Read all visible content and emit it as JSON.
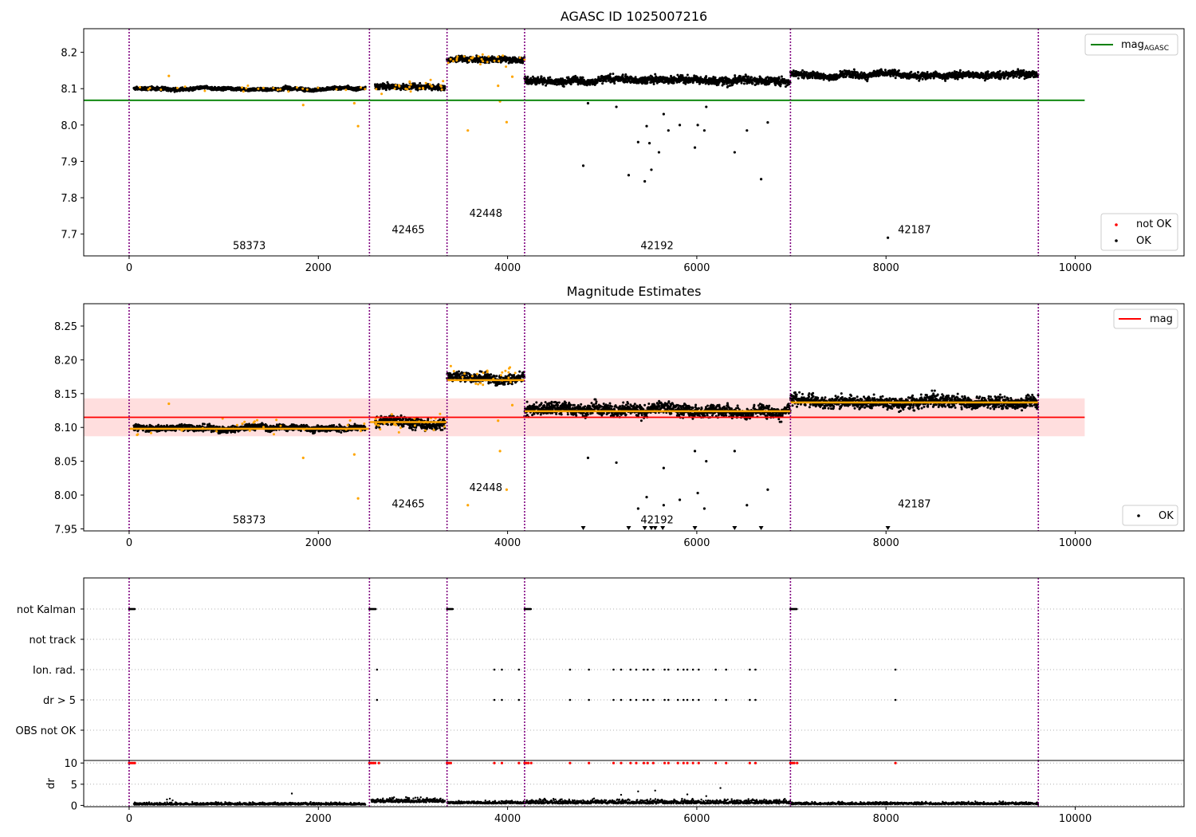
{
  "chart_data": [
    {
      "type": "scatter",
      "title": "AGASC ID 1025007216",
      "xlim": [
        -480,
        11150
      ],
      "ylim": [
        7.64,
        8.265
      ],
      "xticks": [
        "0",
        "2000",
        "4000",
        "6000",
        "8000",
        "10000"
      ],
      "yticks": [
        "7.7",
        "7.8",
        "7.9",
        "8.0",
        "8.1",
        "8.2"
      ],
      "colors": {
        "ok": "#000000",
        "not_ok": "#ff0000",
        "suspect": "#ffa500",
        "agasc_line": "#008000",
        "obsid_line": "#800080"
      },
      "legend_top": [
        {
          "label": "mag",
          "sub": "AGASC",
          "color": "#008000",
          "style": "line"
        }
      ],
      "legend_bottom": [
        {
          "label": "not OK",
          "color": "#ff0000",
          "style": "dot"
        },
        {
          "label": "OK",
          "color": "#000000",
          "style": "dot"
        }
      ],
      "hline": {
        "y": 8.068,
        "x": [
          -480,
          10100
        ]
      },
      "obsid_boundaries": [
        0,
        2540,
        3360,
        4180,
        6990,
        9610
      ],
      "obsid_labels": [
        {
          "text": "58373",
          "x": 1270,
          "y": 7.659
        },
        {
          "text": "42465",
          "x": 2950,
          "y": 7.703
        },
        {
          "text": "42448",
          "x": 3770,
          "y": 7.747
        },
        {
          "text": "42192",
          "x": 5580,
          "y": 7.659
        },
        {
          "text": "42187",
          "x": 8300,
          "y": 7.703
        }
      ],
      "segments": [
        {
          "x": [
            50,
            2500
          ],
          "level": 8.1,
          "noise": 0.004
        },
        {
          "x": [
            2600,
            3340
          ],
          "level": 8.105,
          "noise": 0.007
        },
        {
          "x": [
            3360,
            4180
          ],
          "level": 8.18,
          "noise": 0.007
        },
        {
          "x": [
            4180,
            6990
          ],
          "level": 8.125,
          "noise": 0.009
        },
        {
          "x": [
            6990,
            9610
          ],
          "level": 8.14,
          "noise": 0.008
        }
      ],
      "outliers_ok": [
        [
          4800,
          7.888
        ],
        [
          5280,
          7.862
        ],
        [
          5450,
          7.845
        ],
        [
          5520,
          7.877
        ],
        [
          5380,
          7.953
        ],
        [
          5500,
          7.95
        ],
        [
          5600,
          7.925
        ],
        [
          5980,
          7.938
        ],
        [
          6400,
          7.925
        ],
        [
          6680,
          7.851
        ],
        [
          6750,
          8.007
        ],
        [
          5470,
          7.997
        ],
        [
          5700,
          7.985
        ],
        [
          5820,
          8.0
        ],
        [
          6010,
          8.0
        ],
        [
          6080,
          7.985
        ],
        [
          6530,
          7.985
        ],
        [
          8020,
          7.69
        ],
        [
          4850,
          8.06
        ],
        [
          5150,
          8.05
        ],
        [
          5650,
          8.03
        ],
        [
          6100,
          8.05
        ]
      ],
      "outliers_suspect": [
        [
          1840,
          8.055
        ],
        [
          2420,
          7.997
        ],
        [
          3580,
          7.985
        ],
        [
          3990,
          8.008
        ],
        [
          3920,
          8.065
        ],
        [
          3900,
          8.108
        ],
        [
          4050,
          8.133
        ],
        [
          2380,
          8.06
        ],
        [
          420,
          8.135
        ]
      ]
    },
    {
      "type": "scatter",
      "title": "Magnitude Estimates",
      "xlim": [
        -480,
        11150
      ],
      "ylim": [
        7.947,
        8.283
      ],
      "xticks": [
        "0",
        "2000",
        "4000",
        "6000",
        "8000",
        "10000"
      ],
      "yticks": [
        "7.95",
        "8.00",
        "8.05",
        "8.10",
        "8.15",
        "8.20",
        "8.25"
      ],
      "colors": {
        "ok": "#000000",
        "suspect": "#ffa500",
        "mean_line": "#ff0000",
        "band": "#ffc8c8",
        "obsid_mean": "#ffa500",
        "obsid_line": "#800080"
      },
      "legend_top": [
        {
          "label": "mag",
          "color": "#ff0000",
          "style": "line"
        }
      ],
      "legend_bottom": [
        {
          "label": "OK",
          "color": "#000000",
          "style": "dot"
        }
      ],
      "hline": {
        "y": 8.115,
        "x": [
          -480,
          10100
        ]
      },
      "band": {
        "y": [
          8.087,
          8.143
        ],
        "x": [
          -480,
          10100
        ]
      },
      "obsid_means": [
        {
          "x": [
            0,
            2540
          ],
          "y": 8.098
        },
        {
          "x": [
            2540,
            3360
          ],
          "y": 8.108
        },
        {
          "x": [
            3360,
            4180
          ],
          "y": 8.17
        },
        {
          "x": [
            4180,
            6990
          ],
          "y": 8.124
        },
        {
          "x": [
            6990,
            9610
          ],
          "y": 8.137
        }
      ],
      "obsid_boundaries": [
        0,
        2540,
        3360,
        4180,
        6990,
        9610
      ],
      "obsid_labels": [
        {
          "text": "58373",
          "x": 1270,
          "y": 7.958
        },
        {
          "text": "42465",
          "x": 2950,
          "y": 7.982
        },
        {
          "text": "42448",
          "x": 3770,
          "y": 8.006
        },
        {
          "text": "42192",
          "x": 5580,
          "y": 7.958
        },
        {
          "text": "42187",
          "x": 8300,
          "y": 7.982
        }
      ],
      "segments": [
        {
          "x": [
            50,
            2500
          ],
          "level": 8.1,
          "noise": 0.004
        },
        {
          "x": [
            2600,
            3340
          ],
          "level": 8.107,
          "noise": 0.007
        },
        {
          "x": [
            3360,
            4180
          ],
          "level": 8.175,
          "noise": 0.006
        },
        {
          "x": [
            4180,
            6990
          ],
          "level": 8.127,
          "noise": 0.008
        },
        {
          "x": [
            6990,
            9610
          ],
          "level": 8.14,
          "noise": 0.008
        }
      ],
      "outliers_ok": [
        [
          5380,
          7.98
        ],
        [
          5470,
          7.997
        ],
        [
          5650,
          7.985
        ],
        [
          5820,
          7.993
        ],
        [
          6010,
          8.003
        ],
        [
          6080,
          7.98
        ],
        [
          6530,
          7.985
        ],
        [
          6750,
          8.008
        ],
        [
          4850,
          8.055
        ],
        [
          5150,
          8.048
        ],
        [
          5650,
          8.04
        ],
        [
          6100,
          8.05
        ],
        [
          5980,
          8.065
        ],
        [
          6400,
          8.065
        ]
      ],
      "outliers_suspect": [
        [
          1840,
          8.055
        ],
        [
          2420,
          7.995
        ],
        [
          3580,
          7.985
        ],
        [
          3990,
          8.008
        ],
        [
          3920,
          8.065
        ],
        [
          3900,
          8.11
        ],
        [
          4050,
          8.133
        ],
        [
          2380,
          8.06
        ],
        [
          420,
          8.135
        ]
      ],
      "lower_limit_markers_x": [
        4800,
        5280,
        5450,
        5520,
        5560,
        5640,
        5980,
        6400,
        6680,
        8020
      ]
    },
    {
      "type": "scatter",
      "title": "",
      "xlim": [
        -480,
        11150
      ],
      "categories": [
        "not Kalman",
        "not track",
        "Ion. rad.",
        "dr > 5",
        "OBS not OK"
      ],
      "flag_points": {
        "not Kalman": [
          [
            0,
            60
          ],
          [
            2540,
            2610
          ],
          [
            3360,
            3420
          ],
          [
            4180,
            4250
          ],
          [
            6990,
            7060
          ]
        ],
        "Ion. rad.": [
          2620,
          3860,
          3940,
          4120,
          4660,
          4860,
          5120,
          5200,
          5300,
          5360,
          5440,
          5480,
          5540,
          5660,
          5700,
          5800,
          5860,
          5900,
          5960,
          6020,
          6200,
          6310,
          6560,
          6620,
          8100
        ],
        "dr > 5": [
          2620,
          3860,
          3940,
          4120,
          4660,
          4860,
          5120,
          5200,
          5300,
          5360,
          5440,
          5480,
          5540,
          5660,
          5700,
          5800,
          5860,
          5900,
          5960,
          6020,
          6200,
          6310,
          6560,
          6620,
          8100
        ]
      },
      "obsid_boundaries": [
        0,
        2540,
        3360,
        4180,
        6990,
        9610
      ],
      "colors": {
        "point": "#000000",
        "grid": "#b0b0b0",
        "obsid_line": "#800080"
      }
    },
    {
      "type": "scatter",
      "title": "",
      "ylabel": "dr",
      "xlim": [
        -480,
        11150
      ],
      "ylim": [
        -0.3,
        10.6
      ],
      "xticks": [
        "0",
        "2000",
        "4000",
        "6000",
        "8000",
        "10000"
      ],
      "yticks": [
        "0",
        "5",
        "10"
      ],
      "obsid_boundaries": [
        0,
        2540,
        3360,
        4180,
        6990,
        9610
      ],
      "segments": [
        {
          "x": [
            50,
            2500
          ],
          "level": 0.25,
          "noise": 0.25
        },
        {
          "x": [
            2560,
            3340
          ],
          "level": 0.9,
          "noise": 0.45
        },
        {
          "x": [
            3360,
            4180
          ],
          "level": 0.55,
          "noise": 0.3
        },
        {
          "x": [
            4180,
            6990
          ],
          "level": 0.6,
          "noise": 0.45
        },
        {
          "x": [
            6990,
            9610
          ],
          "level": 0.35,
          "noise": 0.25
        }
      ],
      "red_at_10": [
        0,
        20,
        40,
        60,
        2540,
        2560,
        2580,
        2600,
        2640,
        3360,
        3380,
        3400,
        3860,
        3940,
        4120,
        4180,
        4200,
        4220,
        4250,
        4660,
        4860,
        5120,
        5200,
        5300,
        5360,
        5440,
        5480,
        5540,
        5660,
        5700,
        5800,
        5860,
        5900,
        5960,
        6020,
        6200,
        6310,
        6560,
        6620,
        6990,
        7010,
        7030,
        7060,
        8100
      ],
      "extra_points": [
        [
          400,
          1.4
        ],
        [
          430,
          1.6
        ],
        [
          460,
          1.2
        ],
        [
          1720,
          2.8
        ],
        [
          5380,
          3.3
        ],
        [
          5560,
          3.5
        ],
        [
          6250,
          4.1
        ],
        [
          5200,
          2.5
        ],
        [
          5900,
          2.6
        ],
        [
          6100,
          2.2
        ]
      ],
      "colors": {
        "point": "#000000",
        "red": "#ff0000",
        "obsid_line": "#800080"
      }
    }
  ]
}
